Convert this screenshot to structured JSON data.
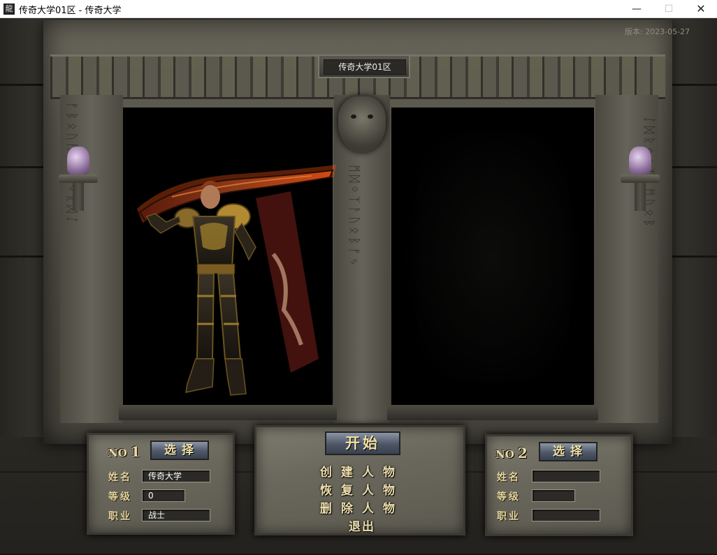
{
  "window": {
    "title": "传奇大学01区 - 传奇大学",
    "icon": "app-logo-icon",
    "minimize": "—",
    "maximize": "☐",
    "close": "✕"
  },
  "game": {
    "server_label": "传奇大学01区",
    "version": "版本: 2023-05-27"
  },
  "slot1": {
    "no_text": "NO",
    "no_num": "1",
    "select_label": "选择",
    "name_label": "姓名",
    "name_value": "传奇大学",
    "level_label": "等级",
    "level_value": "0",
    "job_label": "职业",
    "job_value": "战士"
  },
  "slot2": {
    "no_text": "NO",
    "no_num": "2",
    "select_label": "选择",
    "name_label": "姓名",
    "name_value": "",
    "level_label": "等级",
    "level_value": "",
    "job_label": "职业",
    "job_value": ""
  },
  "menu": {
    "start": "开始",
    "create": "创建人物",
    "restore": "恢复人物",
    "delete": "删除人物",
    "exit": "退出"
  },
  "colors": {
    "label_gold": "#e4d49e",
    "button_blue": "#4e5868",
    "stone": "#6a675b"
  }
}
